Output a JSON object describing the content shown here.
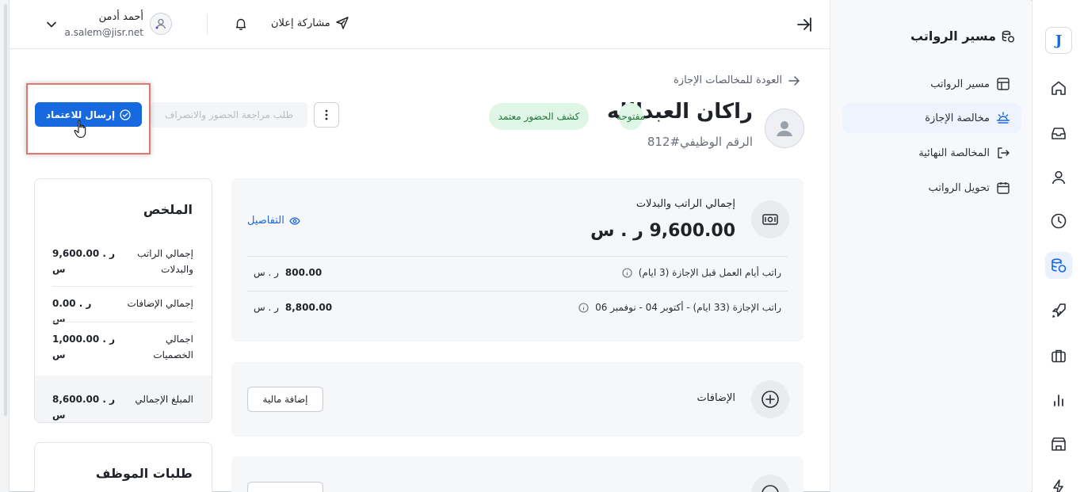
{
  "rail": {
    "logo_letter": "J",
    "icons": [
      "home-icon",
      "inbox-icon",
      "person-icon",
      "clock-icon",
      "payroll-icon",
      "rocket-icon",
      "briefcase-icon",
      "bar-chart-icon",
      "building-icon",
      "bolt-icon"
    ],
    "active": "payroll-icon"
  },
  "subnav": {
    "title": "مسير الرواتب",
    "items": [
      {
        "label": "مسير الرواتب",
        "icon": "table-icon"
      },
      {
        "label": "مخالصة الإجازة",
        "icon": "sunset-icon",
        "active": true
      },
      {
        "label": "المخالصة النهائية",
        "icon": "exit-icon"
      },
      {
        "label": "تحويل الرواتب",
        "icon": "calendar-icon"
      }
    ]
  },
  "header": {
    "share_label": "مشاركة إعلان",
    "user_name": "أحمد أدمن",
    "user_email": "a.salem@jisr.net"
  },
  "page": {
    "back_label": "العودة للمخالصات الإجازة",
    "employee_name": "راكان العبدالله",
    "employee_id": "الرقم الوظيفي#812",
    "badge_status": "مفتوحة",
    "badge_attendance": "كشف الحضور معتمد",
    "review_button": "طلب مراجعة الحضور والانصراف",
    "approve_button": "إرسال للاعتماد"
  },
  "salary_card": {
    "title": "إجمالي الراتب والبدلات",
    "amount": "9,600.00 ر . س",
    "details_label": "التفاصيل",
    "rows": [
      {
        "label": "راتب أيام العمل قبل الإجازة (3 ايام)",
        "value": "800.00",
        "currency": "ر . س"
      },
      {
        "label": "راتب الإجازة (33 ايام) - أكتوبر 04 - نوفمبر 06",
        "value": "8,800.00",
        "currency": "ر . س"
      }
    ]
  },
  "addons_card": {
    "title": "الإضافات",
    "button": "إضافة مالية"
  },
  "summary": {
    "title": "الملخص",
    "rows": [
      {
        "label": "إجمالي الراتب والبدلات",
        "value": "9,600.00 ر . س"
      },
      {
        "label": "إجمالي الإضافات",
        "value": "0.00 ر . س"
      },
      {
        "label": "اجمالي الخصميات",
        "value": "1,000.00 ر . س"
      }
    ],
    "total_label": "المبلغ الإجمالي",
    "total_value": "8,600.00 ر . س"
  },
  "requests": {
    "title": "طلبات الموظف"
  },
  "colors": {
    "primary": "#1769e0",
    "badge_bg": "#dff5e5",
    "badge_text": "#1d7a3b",
    "highlight": "#e0776a"
  }
}
